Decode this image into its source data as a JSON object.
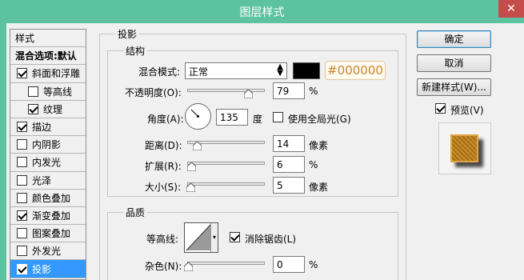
{
  "window": {
    "title": "图层样式",
    "close_label": "✕"
  },
  "style_list": {
    "header": "样式",
    "blend_options": "混合选项:默认",
    "items": [
      {
        "label": "斜面和浮雕",
        "checked": true,
        "sub": false
      },
      {
        "label": "等高线",
        "checked": false,
        "sub": true
      },
      {
        "label": "纹理",
        "checked": true,
        "sub": true
      },
      {
        "label": "描边",
        "checked": true,
        "sub": false
      },
      {
        "label": "内阴影",
        "checked": false,
        "sub": false
      },
      {
        "label": "内发光",
        "checked": false,
        "sub": false
      },
      {
        "label": "光泽",
        "checked": false,
        "sub": false
      },
      {
        "label": "颜色叠加",
        "checked": false,
        "sub": false
      },
      {
        "label": "渐变叠加",
        "checked": true,
        "sub": false
      },
      {
        "label": "图案叠加",
        "checked": false,
        "sub": false
      },
      {
        "label": "外发光",
        "checked": false,
        "sub": false
      },
      {
        "label": "投影",
        "checked": true,
        "sub": false,
        "active": true
      }
    ]
  },
  "panel": {
    "title": "投影",
    "structure": {
      "title": "结构",
      "blend_mode_label": "混合模式:",
      "blend_mode_value": "正常",
      "color_hex": "#000000",
      "opacity_label": "不透明度(O):",
      "opacity_value": "79",
      "opacity_unit": "%",
      "angle_label": "角度(A):",
      "angle_value": "135",
      "angle_unit": "度",
      "global_light_label": "使用全局光(G)",
      "distance_label": "距离(D):",
      "distance_value": "14",
      "distance_unit": "像素",
      "spread_label": "扩展(R):",
      "spread_value": "6",
      "spread_unit": "%",
      "size_label": "大小(S):",
      "size_value": "5",
      "size_unit": "像素"
    },
    "quality": {
      "title": "品质",
      "contour_label": "等高线:",
      "antialias_label": "消除锯齿(L)",
      "noise_label": "杂色(N):",
      "noise_value": "0",
      "noise_unit": "%"
    }
  },
  "buttons": {
    "ok": "确定",
    "cancel": "取消",
    "new_style": "新建样式(W)...",
    "preview_label": "预览(V)"
  },
  "colors": {
    "titlebar": "#5cc29f",
    "active_item": "#3399ff",
    "hex_text": "#c8862a"
  }
}
